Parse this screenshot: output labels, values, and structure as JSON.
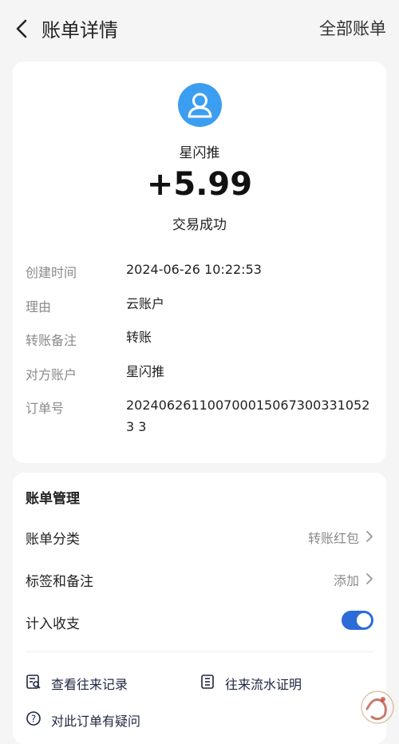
{
  "header": {
    "title": "账单详情",
    "right_link": "全部账单"
  },
  "summary": {
    "counterparty": "星闪推",
    "amount": "+5.99",
    "status": "交易成功"
  },
  "details": [
    {
      "label": "创建时间",
      "value": "2024-06-26 10:22:53"
    },
    {
      "label": "理由",
      "value": "云账户"
    },
    {
      "label": "转账备注",
      "value": "转账"
    },
    {
      "label": "对方账户",
      "value": "星闪推"
    },
    {
      "label": "订单号",
      "value": "2024062611007000150673003310523 3"
    }
  ],
  "management": {
    "title": "账单管理",
    "category_label": "账单分类",
    "category_value": "转账红包",
    "tags_label": "标签和备注",
    "tags_value": "添加",
    "include_label": "计入收支",
    "include_on": true,
    "view_history": "查看往来记录",
    "statement": "往来流水证明",
    "question": "对此订单有疑问"
  },
  "colors": {
    "accent": "#2d6bd8",
    "avatar": "#3c9ef0"
  }
}
